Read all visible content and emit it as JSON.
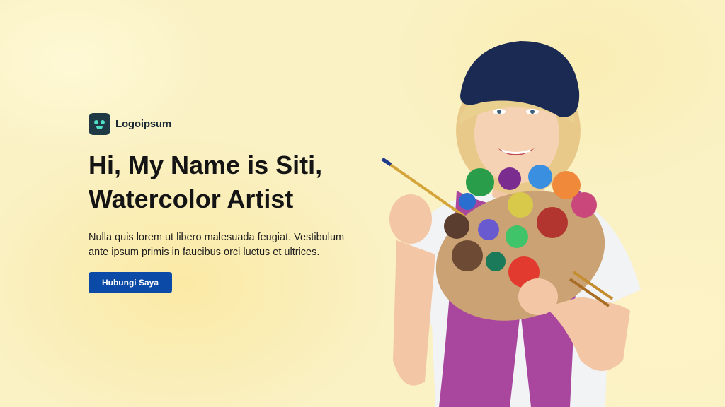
{
  "brand": {
    "name": "Logoipsum"
  },
  "hero": {
    "headline_line1": "Hi, My Name is Siti,",
    "headline_line2": "Watercolor Artist",
    "description_line1": "Nulla quis lorem ut libero malesuada feugiat. Vestibulum",
    "description_line2": "ante ipsum primis in faucibus orci luctus et ultrices.",
    "cta_label": "Hubungi Saya"
  },
  "colors": {
    "background": "#faf1c4",
    "accent": "#0b4aa6",
    "heading": "#141414",
    "logo_mark": "#1f3a45"
  },
  "icons": {
    "logo": "smiley-logo-icon"
  }
}
